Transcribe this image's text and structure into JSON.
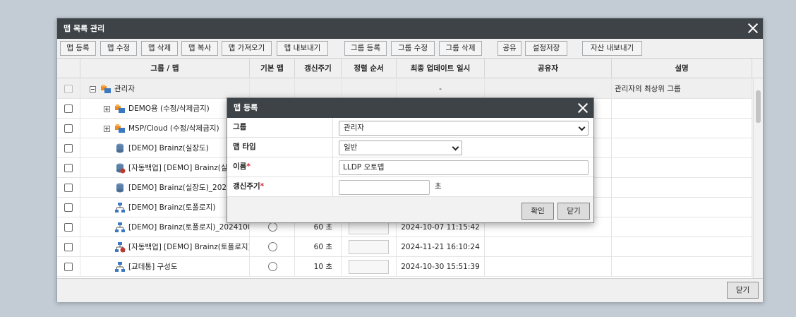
{
  "dialog": {
    "title": "맵 목록 관리",
    "footer_close": "닫기"
  },
  "toolbar": {
    "buttons": [
      "맵 등록",
      "맵 수정",
      "맵 삭제",
      "맵 복사",
      "맵 가져오기",
      "맵 내보내기",
      "그룹 등록",
      "그룹 수정",
      "그룹 삭제",
      "공유",
      "설정저장",
      "자산 내보내기"
    ]
  },
  "grid": {
    "columns": [
      "그룹 / 맵",
      "기본 맵",
      "갱신주기",
      "정렬 순서",
      "최종 업데이트 일시",
      "공유자",
      "설명"
    ],
    "rows": [
      {
        "name": "관리자",
        "icon": "group-icon",
        "period": "",
        "updated": "-",
        "desc": "관리자의 최상위 그룹"
      },
      {
        "name": "DEMO용 (수정/삭제금지)",
        "icon": "group-icon",
        "period": "",
        "updated": "",
        "desc": ""
      },
      {
        "name": "MSP/Cloud (수정/삭제금지)",
        "icon": "group-icon",
        "period": "",
        "updated": "",
        "desc": ""
      },
      {
        "name": "[DEMO] Brainz(실장도)",
        "icon": "floor-map-icon",
        "period": "",
        "updated": "",
        "desc": ""
      },
      {
        "name": "[자동백업] [DEMO] Brainz(실장도)",
        "icon": "floor-map-backup-icon",
        "period": "",
        "updated": "",
        "desc": ""
      },
      {
        "name": "[DEMO] Brainz(실장도)_20241007",
        "icon": "floor-map-icon",
        "period": "",
        "updated": "",
        "desc": ""
      },
      {
        "name": "[DEMO] Brainz(토폴로지)",
        "icon": "topology-icon",
        "period": "",
        "updated": "",
        "desc": ""
      },
      {
        "name": "[DEMO] Brainz(토폴로지)_20241007",
        "icon": "topology-icon",
        "period": "60 초",
        "updated": "2024-10-07 11:15:42",
        "desc": ""
      },
      {
        "name": "[자동백업] [DEMO] Brainz(토폴로지)",
        "icon": "topology-backup-icon",
        "period": "60 초",
        "updated": "2024-11-21 16:10:24",
        "desc": ""
      },
      {
        "name": "[교데통] 구성도",
        "icon": "topology-icon",
        "period": "10 초",
        "updated": "2024-10-30 15:51:39",
        "desc": ""
      }
    ]
  },
  "modal": {
    "title": "맵 등록",
    "group_label": "그룹",
    "group_value": "관리자",
    "type_label": "맵 타입",
    "type_value": "일반",
    "name_label": "이름",
    "name_value": "LLDP 오토맵",
    "period_label": "갱신주기",
    "period_value": "",
    "period_unit": "초",
    "required_mark": "*",
    "confirm": "확인",
    "close": "닫기"
  },
  "colors": {
    "title_bar": "#3d4347",
    "required": "#d9222a",
    "group_icon_orange": "#f08a1c",
    "map_icon_blue": "#3a78c2"
  }
}
